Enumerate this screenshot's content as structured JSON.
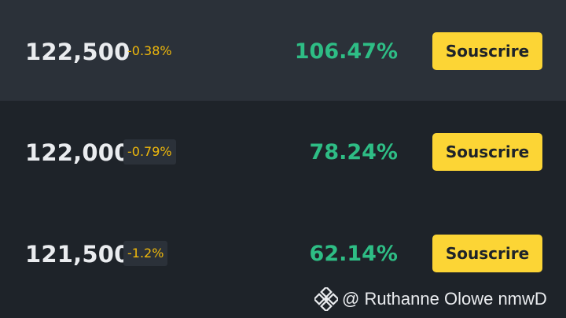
{
  "rows": [
    {
      "strike": "122,500",
      "change": "-0.38%",
      "rate": "106.47%",
      "action_label": "Souscrire"
    },
    {
      "strike": "122,000",
      "change": "-0.79%",
      "rate": "78.24%",
      "action_label": "Souscrire"
    },
    {
      "strike": "121,500",
      "change": "-1.2%",
      "rate": "62.14%",
      "action_label": "Souscrire"
    }
  ],
  "watermark": {
    "logo_icon": "binance-logo-icon",
    "handle": "@ Ruthanne Olowe nmwD"
  },
  "colors": {
    "background": "#1e2329",
    "row_highlight": "#2b3139",
    "text_primary": "#eaecef",
    "negative_change": "#f0b90b",
    "rate_green": "#2ebd85",
    "button_yellow": "#fcd535"
  }
}
